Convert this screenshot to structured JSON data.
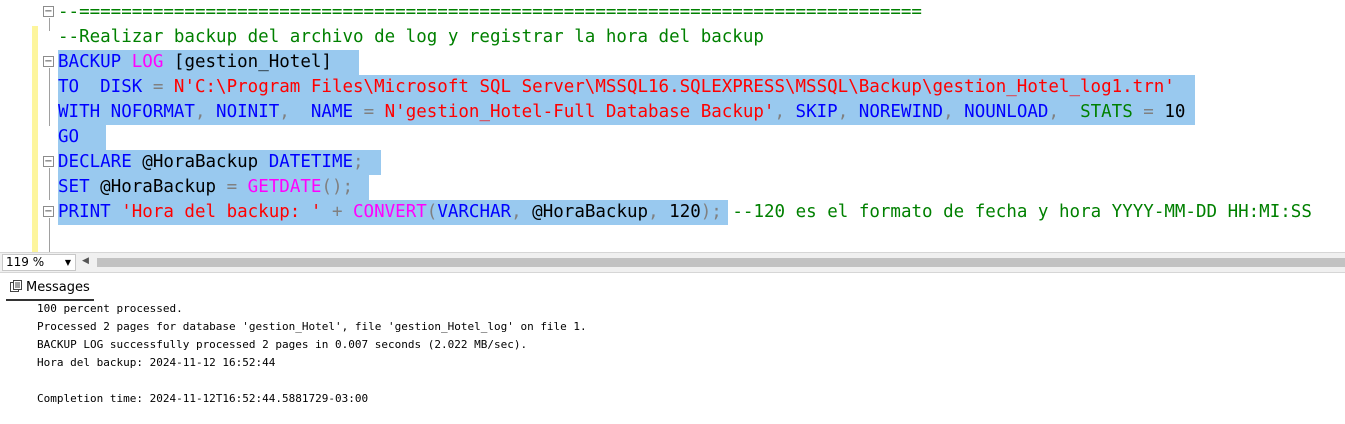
{
  "editor": {
    "lines": [
      {
        "parts": [
          {
            "c": "cm",
            "t": "--================================================================================"
          }
        ]
      },
      {
        "parts": [
          {
            "c": "cm",
            "t": "--Realizar backup del archivo de log y registrar la hora del backup"
          }
        ]
      },
      {
        "parts": [
          {
            "c": "kw",
            "t": "BACKUP "
          },
          {
            "c": "fn",
            "t": "LOG"
          },
          {
            "c": "tx",
            "t": " [gestion_Hotel]"
          }
        ]
      },
      {
        "parts": [
          {
            "c": "kw",
            "t": "TO  DISK "
          },
          {
            "c": "gr",
            "t": "= "
          },
          {
            "c": "str",
            "t": "N'C:\\Program Files\\Microsoft SQL Server\\MSSQL16.SQLEXPRESS\\MSSQL\\Backup\\gestion_Hotel_log1.trn'"
          }
        ]
      },
      {
        "parts": [
          {
            "c": "kw",
            "t": "WITH NOFORMAT"
          },
          {
            "c": "gr",
            "t": ", "
          },
          {
            "c": "kw",
            "t": "NOINIT"
          },
          {
            "c": "gr",
            "t": ",  "
          },
          {
            "c": "kw",
            "t": "NAME "
          },
          {
            "c": "gr",
            "t": "= "
          },
          {
            "c": "str",
            "t": "N'gestion_Hotel-Full Database Backup'"
          },
          {
            "c": "gr",
            "t": ", "
          },
          {
            "c": "kw",
            "t": "SKIP"
          },
          {
            "c": "gr",
            "t": ", "
          },
          {
            "c": "kw",
            "t": "NOREWIND"
          },
          {
            "c": "gr",
            "t": ", "
          },
          {
            "c": "kw",
            "t": "NOUNLOAD"
          },
          {
            "c": "gr",
            "t": ",  "
          },
          {
            "c": "st",
            "t": "STATS"
          },
          {
            "c": "gr",
            "t": " = "
          },
          {
            "c": "tx",
            "t": "10"
          }
        ]
      },
      {
        "parts": [
          {
            "c": "kw",
            "t": "GO"
          }
        ]
      },
      {
        "parts": [
          {
            "c": "kw",
            "t": "DECLARE "
          },
          {
            "c": "tx",
            "t": "@HoraBackup "
          },
          {
            "c": "kw",
            "t": "DATETIME"
          },
          {
            "c": "gr",
            "t": ";"
          }
        ]
      },
      {
        "parts": [
          {
            "c": "kw",
            "t": "SET "
          },
          {
            "c": "tx",
            "t": "@HoraBackup "
          },
          {
            "c": "gr",
            "t": "= "
          },
          {
            "c": "fn",
            "t": "GETDATE"
          },
          {
            "c": "gr",
            "t": "();"
          }
        ]
      },
      {
        "parts": [
          {
            "c": "kw",
            "t": "PRINT "
          },
          {
            "c": "str",
            "t": "'Hora del backup: '"
          },
          {
            "c": "gr",
            "t": " + "
          },
          {
            "c": "fn",
            "t": "CONVERT"
          },
          {
            "c": "gr",
            "t": "("
          },
          {
            "c": "kw",
            "t": "VARCHAR"
          },
          {
            "c": "gr",
            "t": ", "
          },
          {
            "c": "tx",
            "t": "@HoraBackup"
          },
          {
            "c": "gr",
            "t": ", "
          },
          {
            "c": "tx",
            "t": "120"
          },
          {
            "c": "gr",
            "t": ");"
          },
          {
            "c": "tx",
            "t": " "
          },
          {
            "c": "cm",
            "t": "--120 es el formato de fecha y hora YYYY-MM-DD HH:MI:SS"
          }
        ]
      }
    ]
  },
  "status": {
    "zoom": "119 %"
  },
  "results": {
    "tab_label": "Messages",
    "lines": [
      "100 percent processed.",
      "Processed 2 pages for database 'gestion_Hotel', file 'gestion_Hotel_log' on file 1.",
      "BACKUP LOG successfully processed 2 pages in 0.007 seconds (2.022 MB/sec).",
      "Hora del backup: 2024-11-12 16:52:44",
      "",
      "Completion time: 2024-11-12T16:52:44.5881729-03:00"
    ]
  },
  "colors": {
    "selection": "#99c9ef",
    "keyword": "#0000ff",
    "function": "#ff00ff",
    "string": "#ff0000",
    "comment": "#008000"
  }
}
